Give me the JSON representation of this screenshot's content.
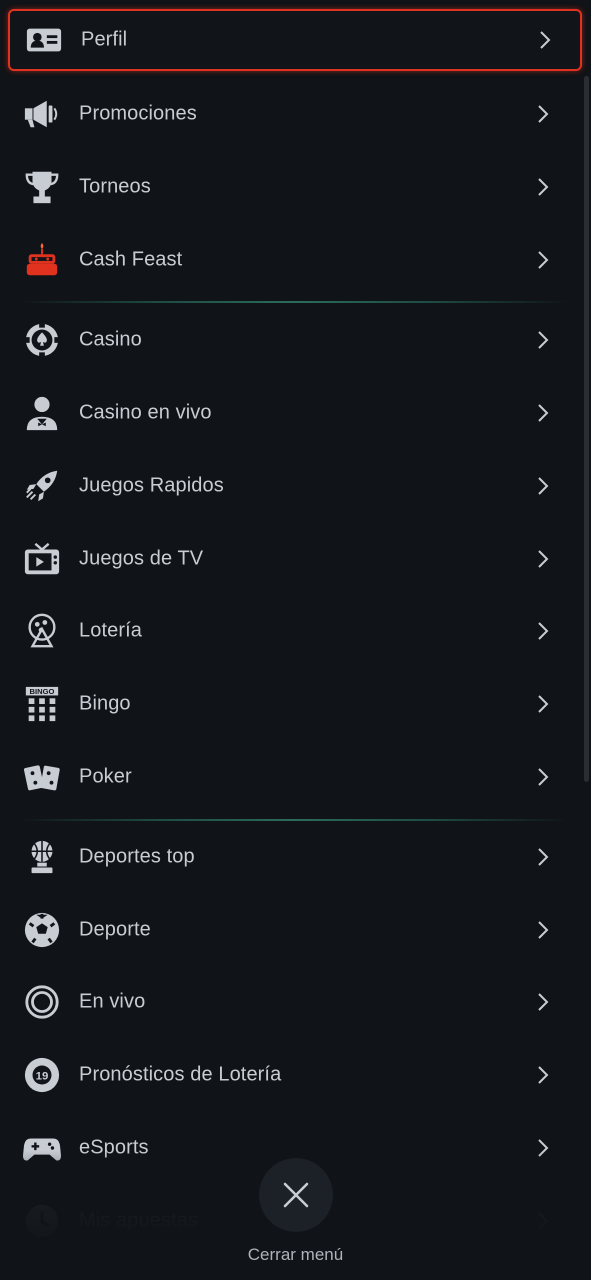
{
  "menu": {
    "items": [
      {
        "label": "Perfil",
        "icon": "profile-card-icon",
        "active": true
      },
      {
        "label": "Promociones",
        "icon": "megaphone-icon"
      },
      {
        "label": "Torneos",
        "icon": "trophy-icon"
      },
      {
        "label": "Cash Feast",
        "icon": "cake-icon"
      },
      {
        "label": "Casino",
        "icon": "casino-chip-icon"
      },
      {
        "label": "Casino en vivo",
        "icon": "dealer-icon"
      },
      {
        "label": "Juegos Rapidos",
        "icon": "rocket-icon"
      },
      {
        "label": "Juegos de TV",
        "icon": "tv-icon"
      },
      {
        "label": "Lotería",
        "icon": "lottery-drum-icon"
      },
      {
        "label": "Bingo",
        "icon": "bingo-icon"
      },
      {
        "label": "Poker",
        "icon": "playing-cards-icon"
      },
      {
        "label": "Deportes top",
        "icon": "basketball-trophy-icon"
      },
      {
        "label": "Deporte",
        "icon": "soccer-ball-icon"
      },
      {
        "label": "En vivo",
        "icon": "live-target-icon"
      },
      {
        "label": "Pronósticos de Lotería",
        "icon": "lottery-ball-icon"
      },
      {
        "label": "eSports",
        "icon": "gamepad-icon"
      },
      {
        "label": "Mis apuestas",
        "icon": "clock-icon"
      }
    ],
    "bingo_icon_text": "BINGO",
    "lottery_ball_text": "19"
  },
  "footer": {
    "close_label": "Cerrar menú"
  },
  "colors": {
    "background": "#101317",
    "active_border": "#e0321e",
    "cake_accent": "#e0321e",
    "divider": "#2b6b5e",
    "text": "#c8cdd4"
  }
}
